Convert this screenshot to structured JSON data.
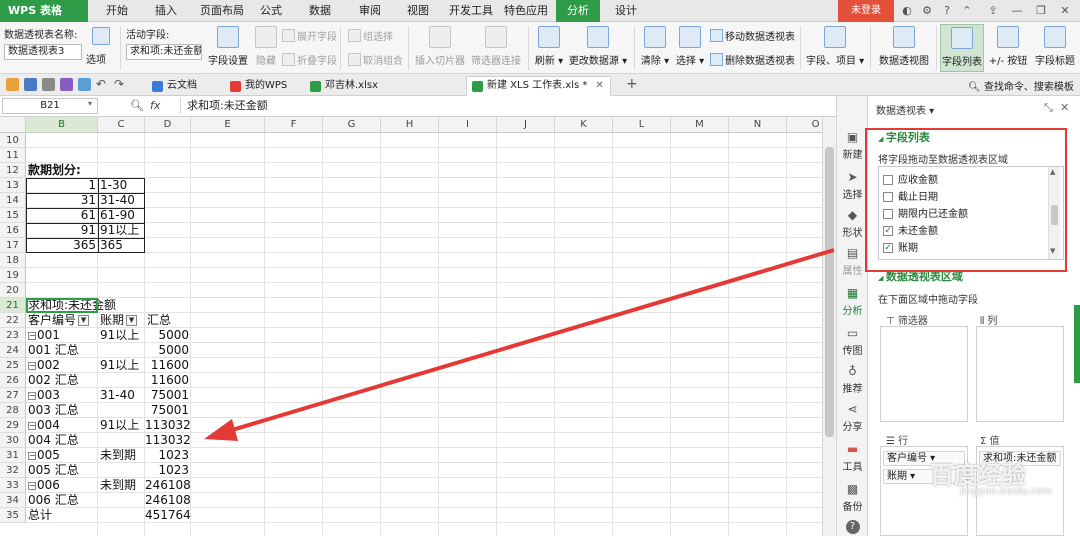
{
  "app": {
    "name": "WPS 表格",
    "login": "未登录"
  },
  "menu": {
    "items": [
      "开始",
      "插入",
      "页面布局",
      "公式",
      "数据",
      "审阅",
      "视图",
      "开发工具",
      "特色应用",
      "分析",
      "设计"
    ],
    "active": "分析"
  },
  "ribbon": {
    "pivot_name_label": "数据透视表名称:",
    "pivot_name_value": "数据透视表3",
    "options": "选项",
    "active_field_label": "活动字段:",
    "active_field_value": "求和项:未还金额",
    "field_settings": "字段设置",
    "hide": "隐藏",
    "expand_field": "展开字段",
    "collapse_field": "折叠字段",
    "group_selection": "组选择",
    "ungroup": "取消组合",
    "insert_slicer": "插入切片器",
    "filter_connection": "筛选器连接",
    "refresh": "刷新",
    "change_source": "更改数据源",
    "clear": "清除",
    "select": "选择",
    "move_pivot": "移动数据透视表",
    "delete_pivot": "删除数据透视表",
    "fields_items": "字段、项目",
    "pivot_chart": "数据透视图",
    "field_list": "字段列表",
    "buttons": "+/- 按钮",
    "field_headers": "字段标题"
  },
  "tabbar": {
    "tabs": [
      {
        "label": "云文档"
      },
      {
        "label": "我的WPS"
      },
      {
        "label": "邓吉林.xlsx"
      },
      {
        "label": "新建 XLS 工作表.xls *"
      }
    ],
    "add": "+",
    "command_search": "查找命令、搜索模板"
  },
  "formula_bar": {
    "cell_ref": "B21",
    "fx": "fx",
    "content": "求和项:未还金额"
  },
  "sheet": {
    "columns": [
      "B",
      "C",
      "D",
      "E",
      "F",
      "G",
      "H",
      "I",
      "J",
      "K",
      "L",
      "M",
      "N",
      "O"
    ],
    "rows": [
      "10",
      "11",
      "12",
      "13",
      "14",
      "15",
      "16",
      "17",
      "18",
      "19",
      "20",
      "21",
      "22",
      "23",
      "24",
      "25",
      "26",
      "27",
      "28",
      "29",
      "30",
      "31",
      "32",
      "33",
      "34",
      "35"
    ],
    "period_title": "款期划分:",
    "periods": [
      {
        "start": "1",
        "label": "1-30"
      },
      {
        "start": "31",
        "label": "31-40"
      },
      {
        "start": "61",
        "label": "61-90"
      },
      {
        "start": "91",
        "label": "91以上"
      },
      {
        "start": "365",
        "label": "365"
      }
    ],
    "pivot_title": "求和项:未还金额",
    "pivot_headers": [
      "客户编号",
      "账期",
      "汇总"
    ],
    "pivot_rows": [
      {
        "a": "001",
        "b": "91以上",
        "c": "5000",
        "expand": true
      },
      {
        "a": "001 汇总",
        "b": "",
        "c": "5000",
        "expand": false
      },
      {
        "a": "002",
        "b": "91以上",
        "c": "11600",
        "expand": true
      },
      {
        "a": "002 汇总",
        "b": "",
        "c": "11600",
        "expand": false
      },
      {
        "a": "003",
        "b": "31-40",
        "c": "75001",
        "expand": true
      },
      {
        "a": "003 汇总",
        "b": "",
        "c": "75001",
        "expand": false
      },
      {
        "a": "004",
        "b": "91以上",
        "c": "113032",
        "expand": true
      },
      {
        "a": "004 汇总",
        "b": "",
        "c": "113032",
        "expand": false
      },
      {
        "a": "005",
        "b": "未到期",
        "c": "1023",
        "expand": true
      },
      {
        "a": "005 汇总",
        "b": "",
        "c": "1023",
        "expand": false
      },
      {
        "a": "006",
        "b": "未到期",
        "c": "246108",
        "expand": true
      },
      {
        "a": "006 汇总",
        "b": "",
        "c": "246108",
        "expand": false
      },
      {
        "a": "总计",
        "b": "",
        "c": "451764",
        "expand": false
      }
    ]
  },
  "side_tools": [
    "新建",
    "选择",
    "形状",
    "属性",
    "分析",
    "传图",
    "推荐",
    "分享",
    "工具",
    "备份"
  ],
  "panel": {
    "title": "数据透视表",
    "field_list_header": "字段列表",
    "field_list_hint": "将字段拖动至数据透视表区域",
    "fields": [
      {
        "label": "应收金额",
        "checked": false
      },
      {
        "label": "截止日期",
        "checked": false
      },
      {
        "label": "期限内已还金额",
        "checked": false
      },
      {
        "label": "未还金额",
        "checked": true
      },
      {
        "label": "账期",
        "checked": true
      }
    ],
    "areas_header": "数据透视表区域",
    "areas_hint": "在下面区域中拖动字段",
    "filter_label": "筛选器",
    "column_label": "列",
    "row_label": "行",
    "value_label": "值",
    "row_items": [
      "客户编号",
      "账期"
    ],
    "value_items": [
      "求和项:未还金额"
    ]
  },
  "watermark": {
    "text": "百度经验",
    "url": "jingyan.baidu.com"
  },
  "colors": {
    "brand": "#2e9b47",
    "annotation": "#e53935",
    "login": "#e5503a"
  }
}
